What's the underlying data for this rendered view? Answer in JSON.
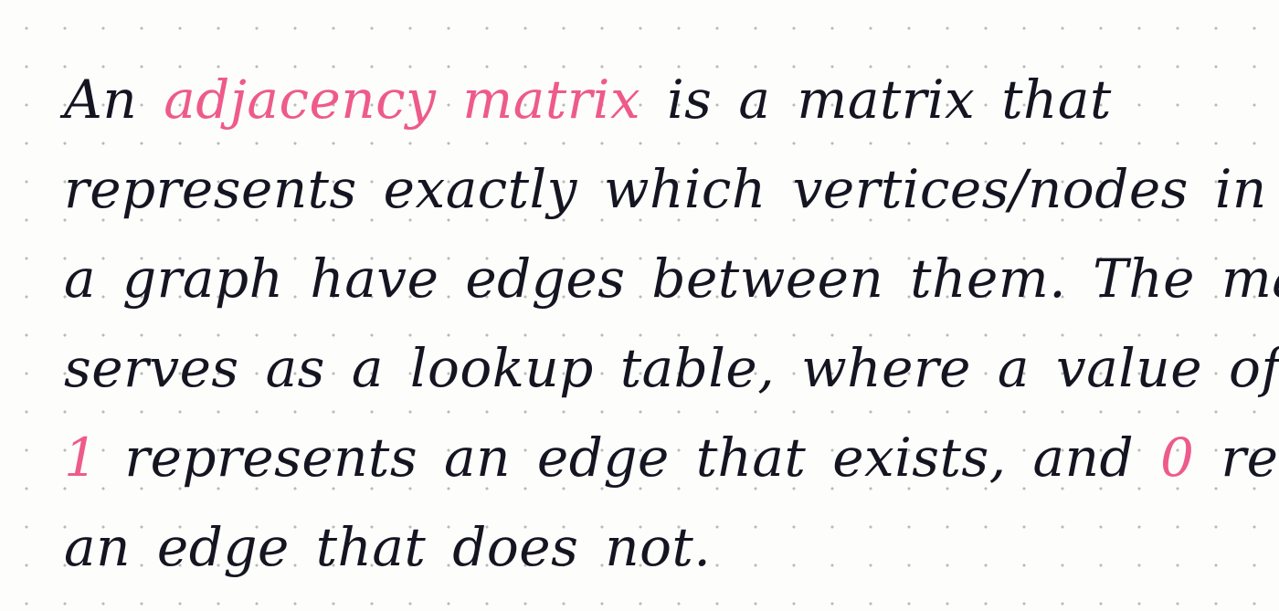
{
  "note": {
    "lines": [
      [
        "An ",
        "adjacency matrix",
        " is a matrix that"
      ],
      [
        "represents exactly which vertices/nodes in"
      ],
      [
        "a graph have edges between them. The matrix"
      ],
      [
        "serves as a lookup table, where a value of"
      ],
      [
        "1",
        " represents an edge that exists, and ",
        "0",
        " represents"
      ],
      [
        "an edge that does not."
      ]
    ]
  },
  "colors": {
    "ink": "#151522",
    "highlight": "#ee5a8c",
    "paper": "#fdfdfc",
    "dot_grid": "#b9b9b9"
  }
}
